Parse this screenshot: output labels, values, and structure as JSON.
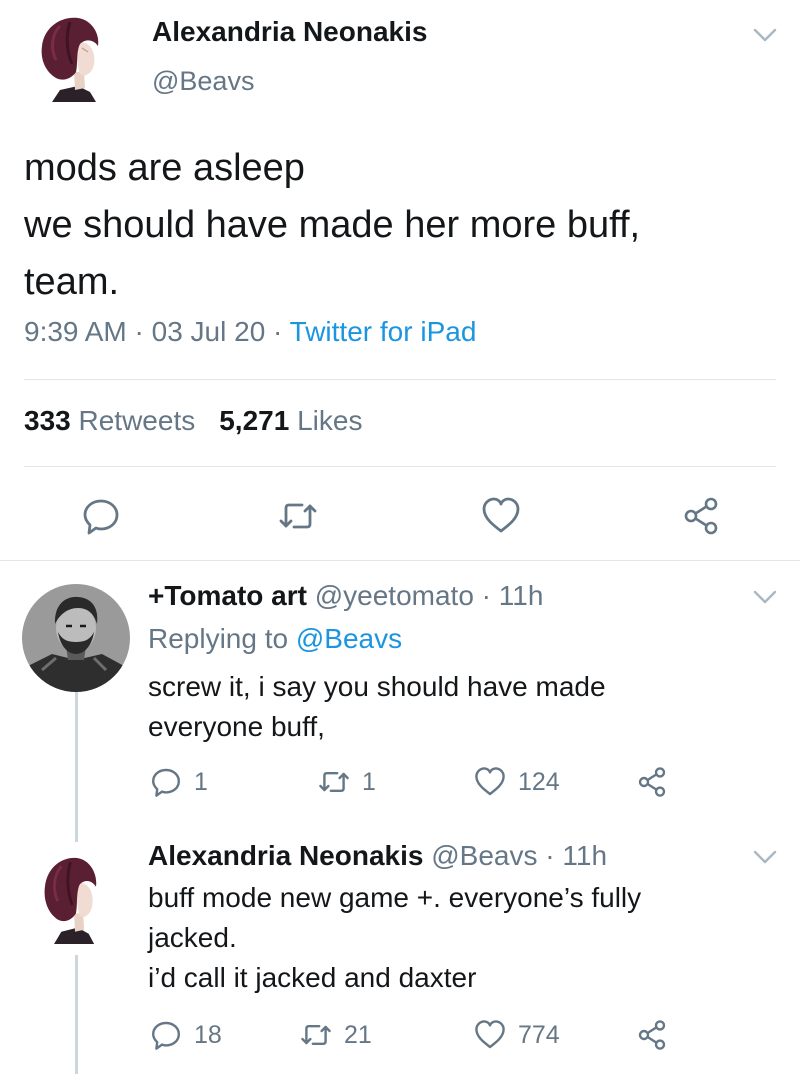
{
  "main_tweet": {
    "author_name": "Alexandria Neonakis",
    "handle": "@Beavs",
    "text": "mods are asleep\nwe should have made her more buff,\nteam.",
    "time": "9:39 AM",
    "date": "03 Jul 20",
    "source": "Twitter for iPad",
    "separator": " · ",
    "retweet_count": "333",
    "retweet_label": "Retweets",
    "like_count": "5,271",
    "like_label": "Likes",
    "icons": [
      "reply-icon",
      "retweet-icon",
      "like-icon",
      "share-icon"
    ]
  },
  "replies": [
    {
      "author_name": "+Tomato art",
      "handle": "@yeetomato",
      "age": "11h",
      "replying_prefix": "Replying to",
      "replying_to": "@Beavs",
      "text": "screw it, i say you should have made\neveryone buff,",
      "reply_count": "1",
      "retweet_count": "1",
      "like_count": "124"
    },
    {
      "author_name": "Alexandria Neonakis",
      "handle": "@Beavs",
      "age": "11h",
      "text": "buff mode new game +. everyone’s fully\njacked.\ni’d call it jacked and daxter",
      "reply_count": "18",
      "retweet_count": "21",
      "like_count": "774"
    }
  ],
  "colors": {
    "text": "#14171a",
    "secondary": "#657786",
    "link": "#1b95e0",
    "divider": "#e1e8ed",
    "thread_line": "#ccd6dd"
  }
}
